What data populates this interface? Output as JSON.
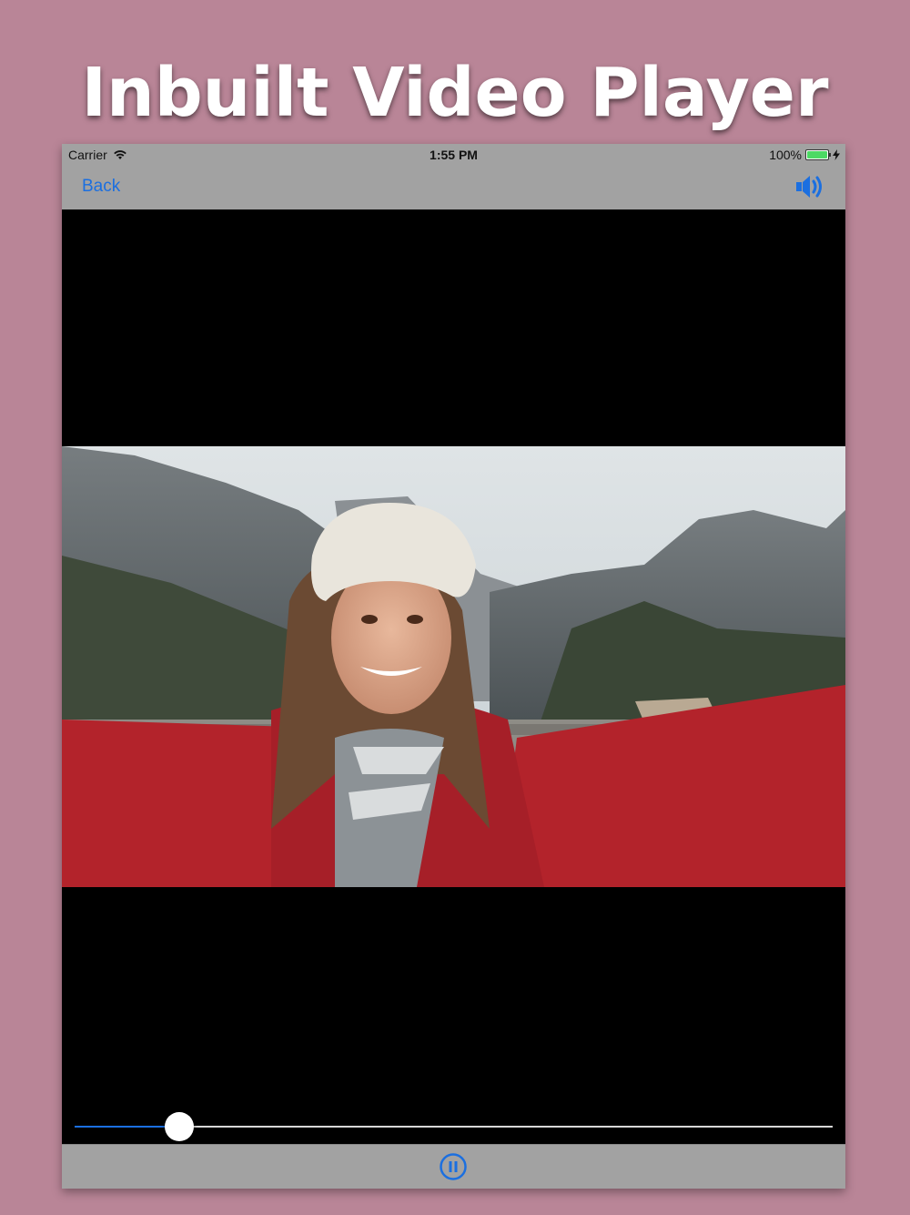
{
  "headline": "Inbuilt Video Player",
  "status_bar": {
    "carrier": "Carrier",
    "time": "1:55 PM",
    "battery": "100%"
  },
  "nav": {
    "back_label": "Back",
    "volume_icon": "speaker-volume-icon"
  },
  "player": {
    "progress_fraction": 0.138,
    "pause_icon": "pause-circle-icon"
  },
  "colors": {
    "background": "#b98597",
    "accent": "#1b6fe0",
    "bar": "#a2a2a2"
  }
}
